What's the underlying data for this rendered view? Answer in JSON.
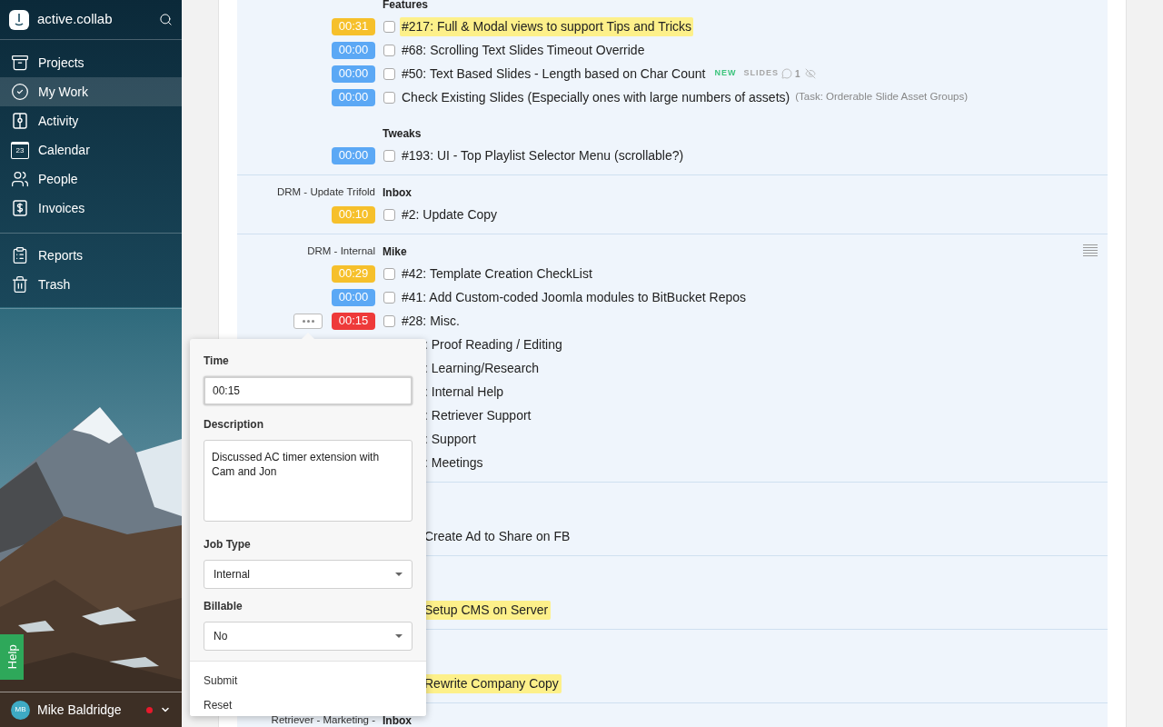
{
  "sidebar": {
    "brand": "active.collab",
    "nav": [
      {
        "label": "Projects",
        "selected": false
      },
      {
        "label": "My Work",
        "selected": true
      },
      {
        "label": "Activity",
        "selected": false
      },
      {
        "label": "Calendar",
        "selected": false,
        "icon_text": "23"
      },
      {
        "label": "People",
        "selected": false
      },
      {
        "label": "Invoices",
        "selected": false
      }
    ],
    "nav_secondary": [
      {
        "label": "Reports",
        "selected": false
      },
      {
        "label": "Trash",
        "selected": false
      }
    ],
    "help": "Help",
    "user": {
      "initials": "MB",
      "name": "Mike Baldridge"
    }
  },
  "sections": [
    {
      "rows": [
        {
          "kind": "heading",
          "text": "Features"
        },
        {
          "kind": "task",
          "timer": "00:31",
          "color": "#f6c02b",
          "checked": false,
          "title": "#217: Full & Modal views to support Tips and Tricks",
          "highlighted": true
        },
        {
          "kind": "task",
          "timer": "00:00",
          "color": "#5ba8f5",
          "checked": false,
          "title": "#68: Scrolling Text Slides Timeout Override",
          "highlighted": false
        },
        {
          "kind": "task",
          "timer": "00:00",
          "color": "#5ba8f5",
          "checked": false,
          "title": "#50: Text Based Slides - Length based on Char Count",
          "highlighted": false,
          "tags": [
            {
              "kind": "new",
              "text": "NEW"
            },
            {
              "kind": "label",
              "text": "SLIDES"
            }
          ],
          "comments": "1",
          "hidden_from_clients": true
        },
        {
          "kind": "task",
          "timer": "00:00",
          "color": "#5ba8f5",
          "checked": false,
          "title": "Check Existing Slides (Especially ones with large numbers of assets)",
          "highlighted": false,
          "note": "(Task: Orderable Slide Asset Groups)"
        },
        {
          "kind": "heading",
          "text": "Tweaks"
        },
        {
          "kind": "task",
          "timer": "00:00",
          "color": "#5ba8f5",
          "checked": false,
          "title": "#193: UI - Top Playlist Selector Menu (scrollable?)",
          "highlighted": false
        }
      ]
    },
    {
      "rows": [
        {
          "kind": "heading",
          "project": "DRM - Update Trifold",
          "text": "Inbox"
        },
        {
          "kind": "task",
          "timer": "00:10",
          "color": "#f6c02b",
          "checked": false,
          "title": "#2: Update Copy",
          "highlighted": false
        }
      ]
    },
    {
      "list_view": true,
      "rows": [
        {
          "kind": "heading",
          "project": "DRM - Internal",
          "text": "Mike"
        },
        {
          "kind": "task",
          "timer": "00:29",
          "color": "#f6c02b",
          "checked": false,
          "title": "#42: Template Creation CheckList",
          "highlighted": false
        },
        {
          "kind": "task",
          "timer": "00:00",
          "color": "#5ba8f5",
          "checked": false,
          "title": "#41: Add Custom-coded Joomla modules to BitBucket Repos",
          "highlighted": false
        },
        {
          "kind": "task",
          "timer": "00:15",
          "color": "#ee3a3a",
          "checked": false,
          "title": "#28: Misc.",
          "highlighted": false,
          "options_open": true
        },
        {
          "kind": "partial",
          "title": ": Proof Reading / Editing",
          "highlighted": false
        },
        {
          "kind": "partial",
          "title": ": Learning/Research",
          "highlighted": false
        },
        {
          "kind": "partial",
          "title": ": Internal Help",
          "highlighted": false
        },
        {
          "kind": "partial",
          "title": ": Retriever Support",
          "highlighted": false
        },
        {
          "kind": "partial",
          "title": ": Support",
          "highlighted": false
        },
        {
          "kind": "partial",
          "title": ": Meetings",
          "highlighted": false
        }
      ]
    },
    {
      "rows": [
        {
          "kind": "partial",
          "title": "Create Ad to Share on FB",
          "highlighted": false
        }
      ]
    },
    {
      "rows": [
        {
          "kind": "partial",
          "title": "Setup CMS on Server",
          "highlighted": true
        }
      ]
    },
    {
      "rows": [
        {
          "kind": "partial",
          "title": "Rewrite Company Copy",
          "highlighted": true
        }
      ]
    },
    {
      "rows": [
        {
          "kind": "heading",
          "project": "Retriever - Marketing -",
          "text": "Inbox"
        }
      ]
    }
  ],
  "popover": {
    "time_label": "Time",
    "time": "00:15",
    "description_label": "Description",
    "description": "Discussed AC timer extension with Cam and Jon",
    "job_type_label": "Job Type",
    "job_type": "Internal",
    "billable_label": "Billable",
    "billable": "No",
    "actions": [
      "Submit",
      "Reset"
    ]
  }
}
